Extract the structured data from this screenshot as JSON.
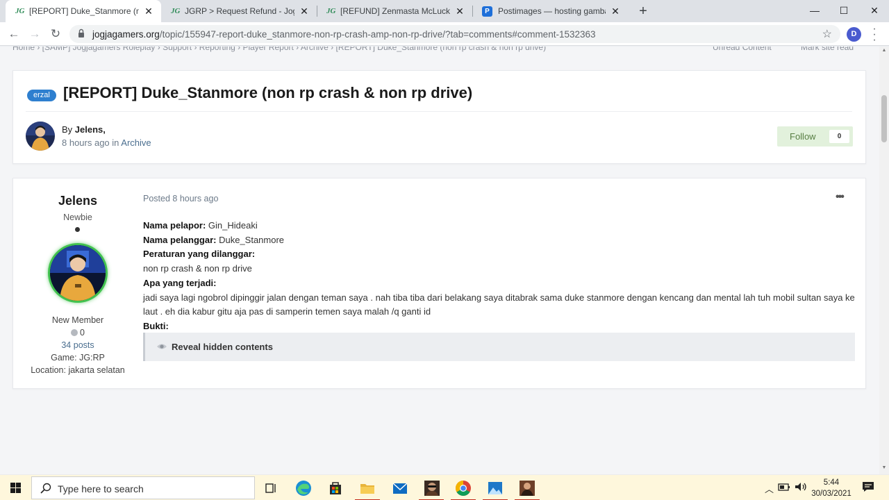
{
  "browser": {
    "tabs": [
      {
        "favicon": "JG",
        "title": "[REPORT] Duke_Stanmore (non rp",
        "active": true
      },
      {
        "favicon": "JG",
        "title": "JGRP > Request Refund - Jogjag",
        "active": false
      },
      {
        "favicon": "JG",
        "title": "[REFUND] Zenmasta McLucky ( R",
        "active": false
      },
      {
        "favicon": "P",
        "title": "Postimages — hosting gambar g",
        "active": false
      }
    ],
    "new_tab_label": "+",
    "window_controls": {
      "minimize": "—",
      "maximize": "☐",
      "close": "✕"
    },
    "url_domain": "jogjagamers.org",
    "url_path": "/topic/155947-report-duke_stanmore-non-rp-crash-amp-non-rp-drive/?tab=comments#comment-1532363",
    "profile_initial": "D"
  },
  "page": {
    "breadcrumb": "Home  ›  [SAMP] Jogjagamers Roleplay  ›  Support  ›  Reporting  ›  Player Report  ›  Archive  ›  [REPORT] Duke_Stanmore (non rp crash & non rp drive)",
    "unread_content": "Unread Content",
    "mark_site_read": "Mark site read",
    "topic": {
      "tag": "erzal",
      "title": "[REPORT] Duke_Stanmore (non rp crash & non rp drive)",
      "by_prefix": "By ",
      "author": "Jelens,",
      "time": "8 hours ago",
      "in_word": " in ",
      "forum": "Archive",
      "follow_label": "Follow",
      "follow_count": "0"
    },
    "post": {
      "username": "Jelens",
      "rank": "Newbie",
      "member_group": "New Member",
      "reputation": "0",
      "posts": "34 posts",
      "game": "Game: JG:RP",
      "location": "Location: jakarta selatan",
      "posted": "Posted 8 hours ago",
      "more_label": "•••",
      "lines": {
        "l1_label": "Nama pelapor:",
        "l1_value": " Gin_Hideaki",
        "l2_label": "Nama pelanggar:",
        "l2_value": " Duke_Stanmore",
        "l3_label": "Peraturan yang dilanggar:",
        "l3_value": "non rp crash & non rp drive",
        "l4_label": "Apa yang terjadi:",
        "l4_value": "jadi saya lagi ngobrol dipinggir jalan dengan teman saya . nah tiba tiba dari belakang saya ditabrak sama duke stanmore dengan kencang dan mental lah tuh mobil sultan saya ke laut . eh dia kabur gitu aja pas di samperin temen saya malah /q ganti id",
        "l5_label": "Bukti:"
      },
      "reveal_label": "Reveal hidden contents"
    }
  },
  "taskbar": {
    "search_placeholder": "Type here to search",
    "time": "5:44",
    "date": "30/03/2021"
  },
  "colors": {
    "accent_blue": "#2e7fcf",
    "follow_green": "#e2f1dc",
    "avatar_ring": "#42c24f",
    "taskbar": "#fef7dc"
  }
}
